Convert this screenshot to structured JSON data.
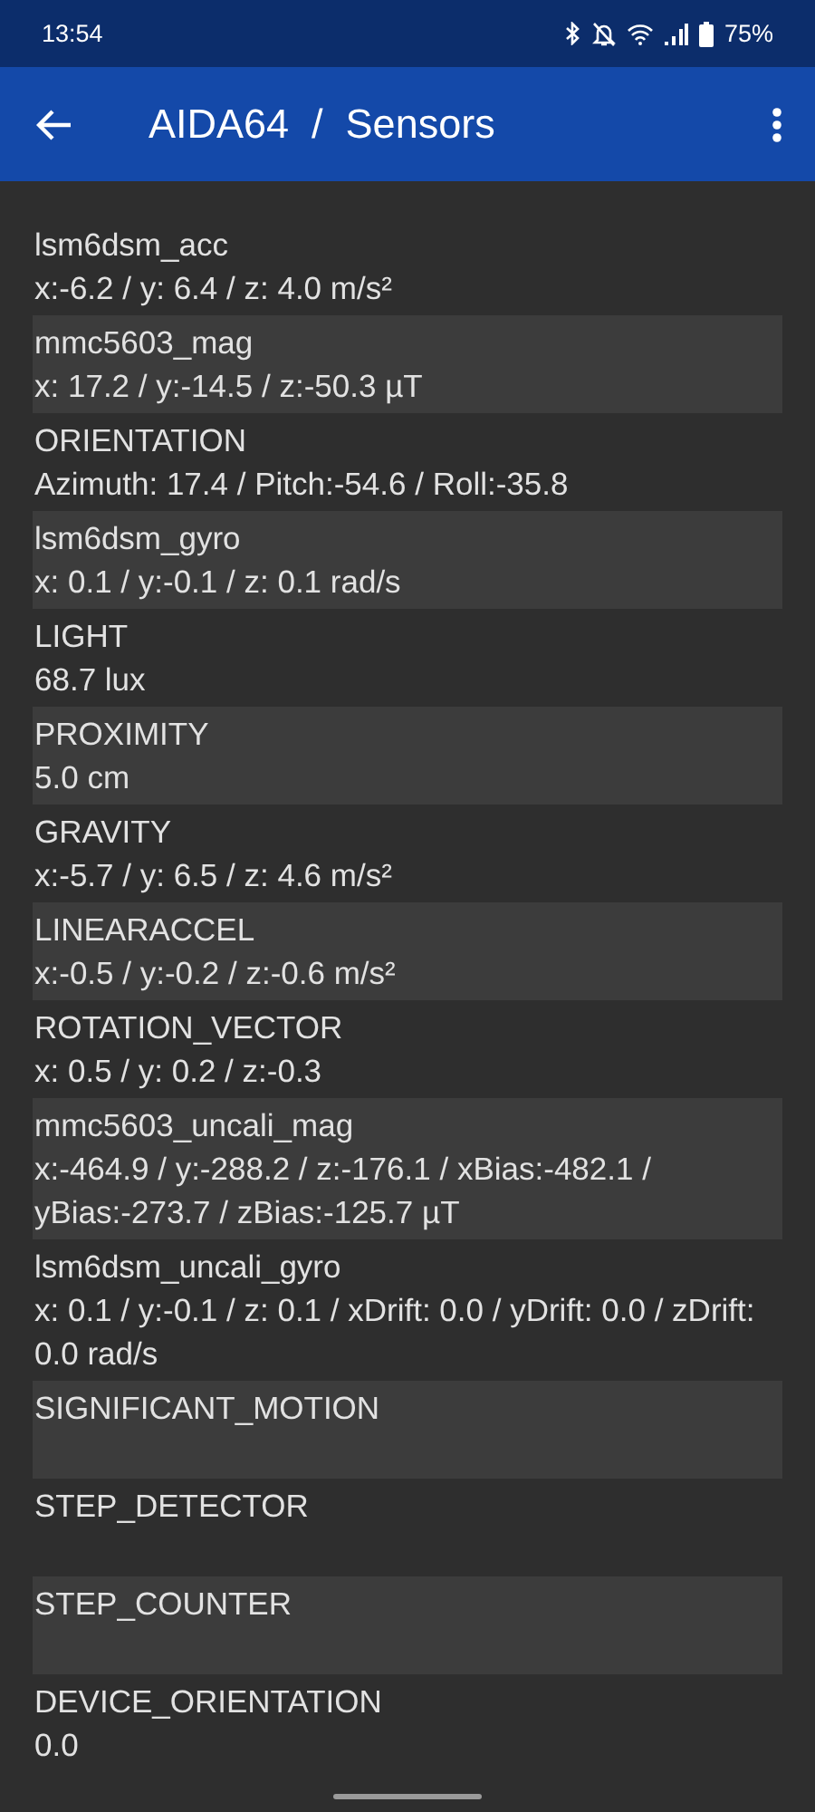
{
  "status_bar": {
    "time": "13:54",
    "battery": "75%"
  },
  "app_bar": {
    "title": "AIDA64  /  Sensors"
  },
  "sensors": [
    {
      "name": "lsm6dsm_acc",
      "value": "x:-6.2 / y: 6.4 / z: 4.0 m/s²"
    },
    {
      "name": "mmc5603_mag",
      "value": "x: 17.2 / y:-14.5 / z:-50.3 µT"
    },
    {
      "name": "ORIENTATION",
      "value": "Azimuth: 17.4 / Pitch:-54.6 / Roll:-35.8"
    },
    {
      "name": "lsm6dsm_gyro",
      "value": "x: 0.1 / y:-0.1 / z: 0.1 rad/s"
    },
    {
      "name": "LIGHT",
      "value": "68.7 lux"
    },
    {
      "name": "PROXIMITY",
      "value": "5.0 cm"
    },
    {
      "name": "GRAVITY",
      "value": "x:-5.7 / y: 6.5 / z: 4.6 m/s²"
    },
    {
      "name": "LINEARACCEL",
      "value": "x:-0.5 / y:-0.2 / z:-0.6 m/s²"
    },
    {
      "name": "ROTATION_VECTOR",
      "value": "x: 0.5 / y: 0.2 / z:-0.3"
    },
    {
      "name": "mmc5603_uncali_mag",
      "value": "x:-464.9 / y:-288.2 / z:-176.1 / xBias:-482.1 / yBias:-273.7 / zBias:-125.7 µT"
    },
    {
      "name": "lsm6dsm_uncali_gyro",
      "value": "x: 0.1 / y:-0.1 / z: 0.1 / xDrift: 0.0 / yDrift: 0.0 / zDrift: 0.0 rad/s"
    },
    {
      "name": "SIGNIFICANT_MOTION"
    },
    {
      "name": "STEP_DETECTOR"
    },
    {
      "name": "STEP_COUNTER"
    },
    {
      "name": "DEVICE_ORIENTATION",
      "value": "0.0"
    }
  ]
}
